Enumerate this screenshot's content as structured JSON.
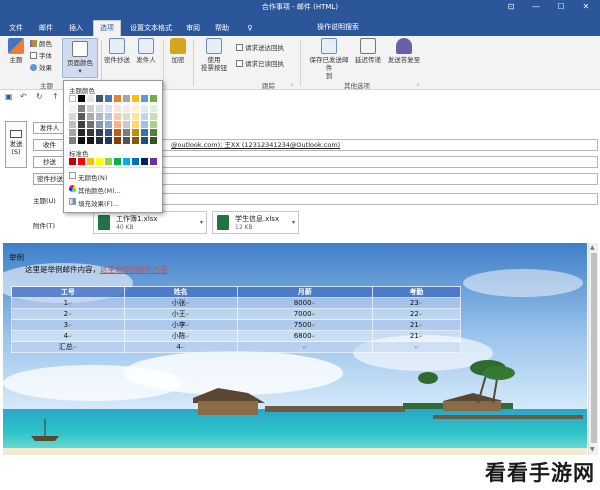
{
  "window": {
    "title": "合作事项 - 邮件 (HTML)",
    "accent": "#2b579a"
  },
  "tabs": [
    {
      "label": "文件",
      "active": false
    },
    {
      "label": "邮件",
      "active": false
    },
    {
      "label": "插入",
      "active": false
    },
    {
      "label": "选项",
      "active": true
    },
    {
      "label": "设置文本格式",
      "active": false
    },
    {
      "label": "审阅",
      "active": false
    },
    {
      "label": "帮助",
      "active": false
    }
  ],
  "tell_me": "操作说明搜索",
  "ribbon": {
    "theme": "主题",
    "colors": "颜色",
    "fonts": "字体",
    "effects": "效果",
    "page_color": "页面颜色",
    "group_theme": "主题",
    "bcc": "密件抄送",
    "from": "发件人",
    "encrypt": "加密",
    "voting_1": "使用",
    "voting_2": "投票按钮",
    "delivery_receipt": "请求送达回执",
    "read_receipt": "请求已读回执",
    "group_tracking": "跟踪",
    "save_sent_1": "保存已发送邮件",
    "save_sent_2": "到",
    "delay_delivery": "延迟传递",
    "direct_replies": "发送答复至",
    "group_more": "其他选项"
  },
  "color_menu": {
    "theme_colors_label": "主题颜色",
    "theme_rows": [
      [
        "#ffffff",
        "#000000",
        "#e7e6e6",
        "#44546a",
        "#4472c4",
        "#ed7d31",
        "#a5a5a5",
        "#ffc000",
        "#5b9bd5",
        "#70ad47"
      ],
      [
        "#f2f2f2",
        "#7f7f7f",
        "#d0cece",
        "#d6dce4",
        "#d9e2f3",
        "#fbe5d5",
        "#ededed",
        "#fff2cc",
        "#deebf6",
        "#e2efd9"
      ],
      [
        "#d8d8d8",
        "#595959",
        "#aeaaaa",
        "#adb9ca",
        "#b4c6e7",
        "#f7cbac",
        "#dbdbdb",
        "#fee599",
        "#bdd7ee",
        "#c5e0b3"
      ],
      [
        "#bfbfbf",
        "#3f3f3f",
        "#757070",
        "#8496b0",
        "#8eaadb",
        "#f4b183",
        "#c9c9c9",
        "#ffd965",
        "#9cc3e5",
        "#a8d08d"
      ],
      [
        "#a5a5a5",
        "#262626",
        "#3a3838",
        "#323f4f",
        "#2f5496",
        "#c55a11",
        "#7b7b7b",
        "#bf9000",
        "#2e75b5",
        "#538135"
      ],
      [
        "#7f7f7f",
        "#0c0c0c",
        "#171616",
        "#222a35",
        "#1f3864",
        "#833c0b",
        "#525252",
        "#7f6000",
        "#1e4e79",
        "#375623"
      ]
    ],
    "standard_label": "标准色",
    "standard_colors": [
      "#c00000",
      "#ff0000",
      "#ffc000",
      "#ffff00",
      "#92d050",
      "#00b050",
      "#00b0f0",
      "#0070c0",
      "#002060",
      "#7030a0"
    ],
    "no_color": "无颜色(N)",
    "more_colors": "其他颜色(M)...",
    "fill_effects": "填充效果(F)..."
  },
  "header": {
    "send_1": "发送",
    "send_2": "(S)",
    "from_btn": "发件人",
    "to_btn": "收件",
    "cc_btn": "抄送",
    "bcc_btn": "密件抄送",
    "to_value": "@outlook.com); 王XX (12312341234@Outlook.com)",
    "subject_label": "主题(U)",
    "attach_label": "附件(T)"
  },
  "attachments": [
    {
      "name": "工作簿1.xlsx",
      "size": "40 KB"
    },
    {
      "name": "学生信息.xlsx",
      "size": "12 KB"
    }
  ],
  "email": {
    "greeting": "举例",
    "line_prefix": "这里是举例邮件内容",
    "line_link": "这里是举例邮件内容",
    "columns": [
      "工号",
      "姓名",
      "月薪",
      "考勤"
    ],
    "rows": [
      [
        "1",
        "小张",
        "8000",
        "23"
      ],
      [
        "2",
        "小王",
        "7000",
        "22"
      ],
      [
        "3",
        "小李",
        "7500",
        "21"
      ],
      [
        "4",
        "小陈",
        "6800",
        "21"
      ],
      [
        "汇总",
        "4",
        "",
        ""
      ]
    ]
  },
  "watermark": "看看手游网"
}
